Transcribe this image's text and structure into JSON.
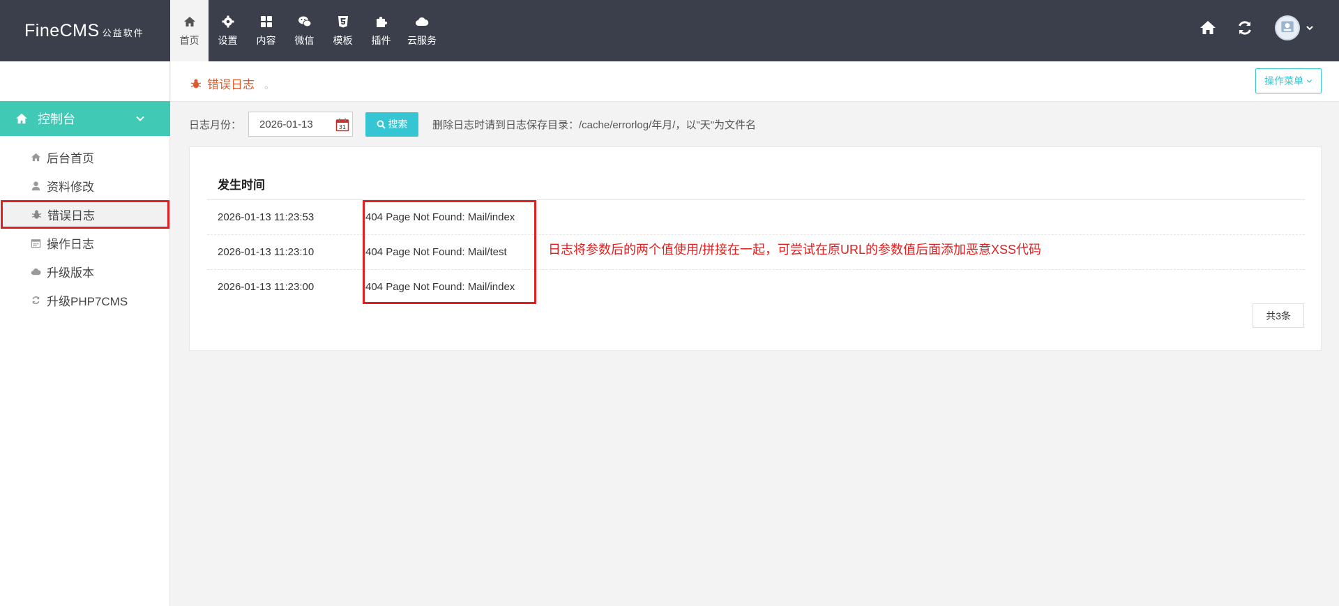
{
  "app": {
    "brand": "FineCMS",
    "brand_sub": "公益软件"
  },
  "topnav": [
    {
      "label": "首页",
      "icon": "home-icon"
    },
    {
      "label": "设置",
      "icon": "gear-icon"
    },
    {
      "label": "内容",
      "icon": "grid-icon"
    },
    {
      "label": "微信",
      "icon": "wechat-icon"
    },
    {
      "label": "模板",
      "icon": "html5-icon"
    },
    {
      "label": "插件",
      "icon": "puzzle-icon"
    },
    {
      "label": "云服务",
      "icon": "cloud-icon"
    }
  ],
  "sidebar": {
    "section": "控制台",
    "items": [
      {
        "label": "后台首页",
        "icon": "home-icon"
      },
      {
        "label": "资料修改",
        "icon": "user-icon"
      },
      {
        "label": "错误日志",
        "icon": "bug-icon"
      },
      {
        "label": "操作日志",
        "icon": "calendar-icon"
      },
      {
        "label": "升级版本",
        "icon": "cloud-icon"
      },
      {
        "label": "升级PHP7CMS",
        "icon": "refresh-icon"
      }
    ]
  },
  "breadcrumb": {
    "title": "错误日志",
    "dot": "。",
    "ops_button": "操作菜单"
  },
  "filter": {
    "label": "日志月份：",
    "date_value": "2026-01-13",
    "search_label": "搜索",
    "hint": "删除日志时请到日志保存目录：/cache/errorlog/年月/，以\"天\"为文件名"
  },
  "table": {
    "header": "发生时间",
    "rows": [
      {
        "time": "2026-01-13 11:23:53",
        "message": "404 Page Not Found: Mail/index"
      },
      {
        "time": "2026-01-13 11:23:10",
        "message": "404 Page Not Found: Mail/test"
      },
      {
        "time": "2026-01-13 11:23:00",
        "message": "404 Page Not Found: Mail/index"
      }
    ],
    "total": "共3条"
  },
  "annotation": "日志将参数后的两个值使用/拼接在一起，可尝试在原URL的参数值后面添加恶意XSS代码",
  "colors": {
    "topbar": "#3a3f4b",
    "accent": "#40c9b5",
    "button": "#36c6d3",
    "highlight": "#e02020",
    "title": "#e05a2b"
  }
}
